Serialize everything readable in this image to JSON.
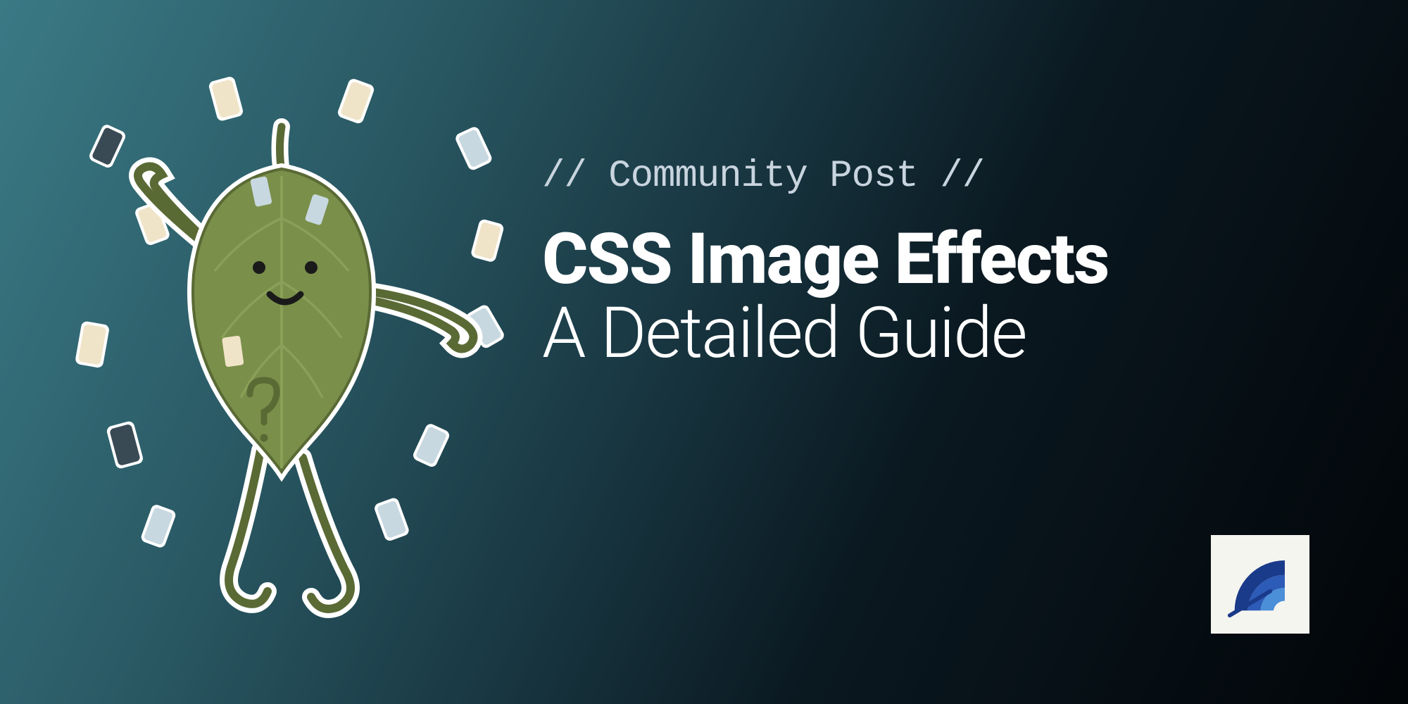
{
  "eyebrow": "// Community Post //",
  "title_bold": "CSS Image Effects",
  "title_light": "A Detailed Guide",
  "illustration": "leaf-character-with-confetti",
  "logo": "calibre-speed-logo",
  "colors": {
    "bg_teal": "#3a7a85",
    "bg_dark": "#020508",
    "leaf_green": "#7a8f4a",
    "leaf_outline": "#5a6a35",
    "text_white": "#ffffff",
    "text_muted": "#c8d4de",
    "logo_blue_dark": "#1a3a8a",
    "logo_blue_mid": "#2d5bb8",
    "logo_blue_light": "#4a8fd8"
  }
}
